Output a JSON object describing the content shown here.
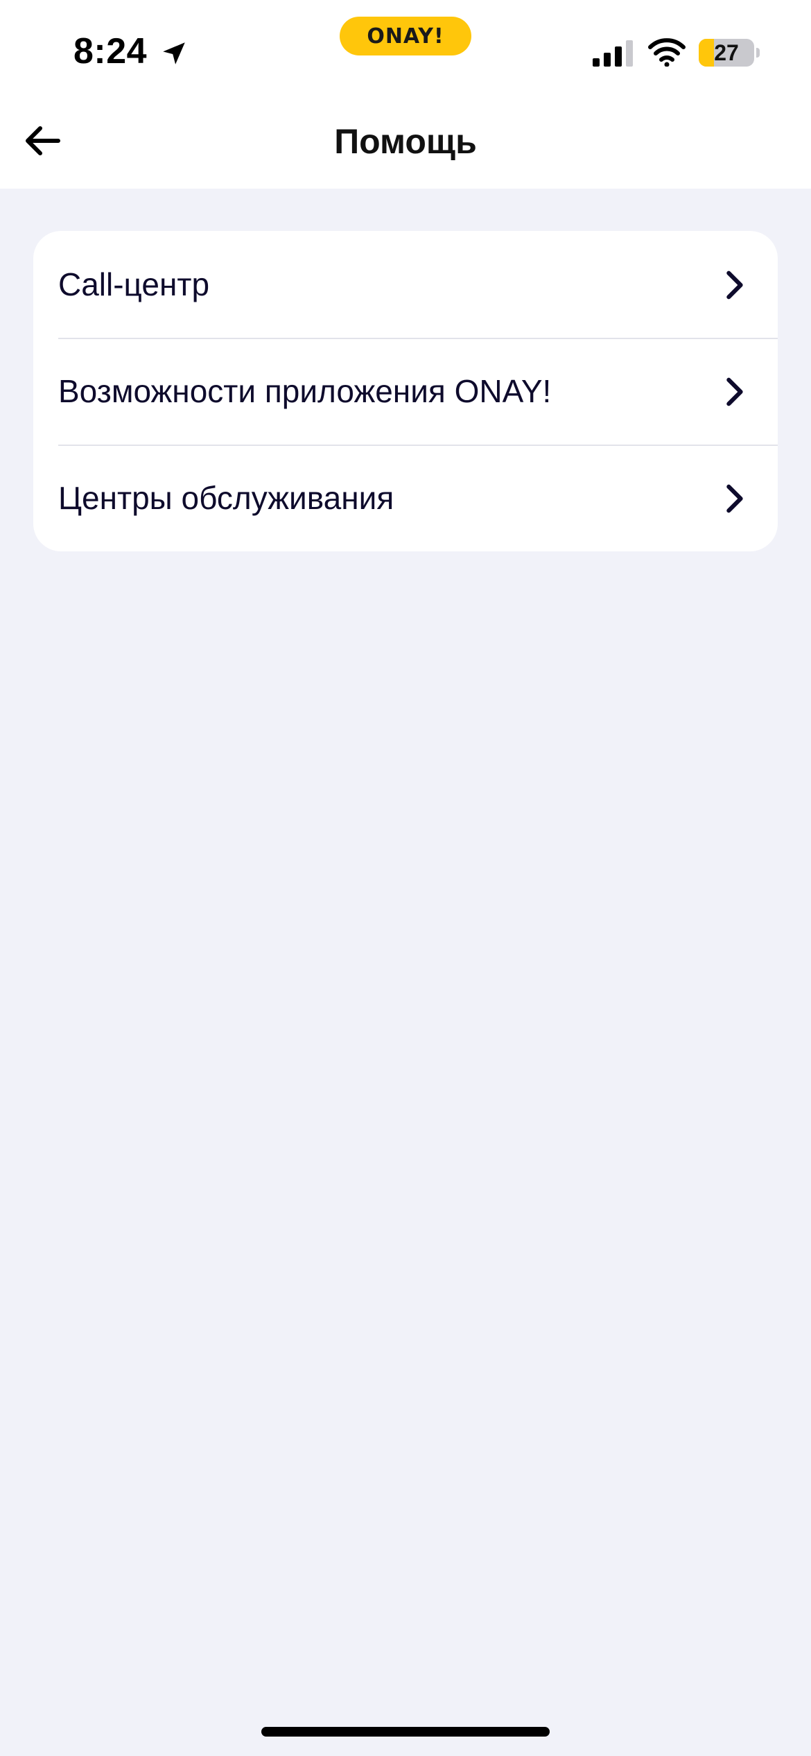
{
  "status_bar": {
    "time": "8:24",
    "brand": "ONAY!",
    "battery_level": "27",
    "battery_fraction": 0.27,
    "icons": [
      "location-arrow-icon",
      "cellular-signal-icon",
      "wifi-icon",
      "battery-icon"
    ]
  },
  "header": {
    "title": "Помощь",
    "back_icon": "arrow-left-icon"
  },
  "menu": {
    "items": [
      {
        "label": "Call-центр",
        "icon": "chevron-right-icon"
      },
      {
        "label": "Возможности приложения ONAY!",
        "icon": "chevron-right-icon"
      },
      {
        "label": "Центры обслуживания",
        "icon": "chevron-right-icon"
      }
    ]
  },
  "colors": {
    "background": "#F1F2F9",
    "surface": "#FFFFFF",
    "brand_yellow": "#FFC60B",
    "text_primary": "#0E0B2C",
    "divider": "#E2E3EA"
  }
}
